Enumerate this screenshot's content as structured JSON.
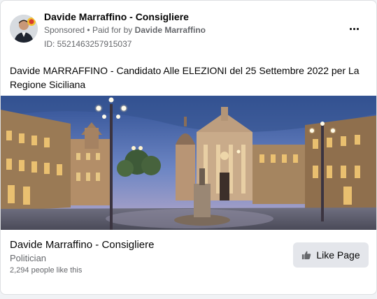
{
  "post": {
    "author": "Davide Marraffino - Consigliere",
    "sponsored_label": "Sponsored",
    "separator": "•",
    "paid_for_prefix": "Paid for by",
    "paid_for_name": "Davide Marraffino",
    "ad_id": "ID: 5521463257915037",
    "text": "Davide MARRAFFINO - Candidato Alle ELEZIONI del 25 Settembre 2022 per La Regione Siciliana"
  },
  "page_card": {
    "name": "Davide Marraffino - Consigliere",
    "category": "Politician",
    "likes": "2,294 people like this",
    "like_button_label": "Like Page"
  },
  "icons": {
    "more": "more-options-icon",
    "like": "thumbs-up-icon"
  },
  "colors": {
    "text_primary": "#050505",
    "text_secondary": "#65676b",
    "button_bg": "#e4e6eb",
    "card_border": "#dddfe2"
  }
}
